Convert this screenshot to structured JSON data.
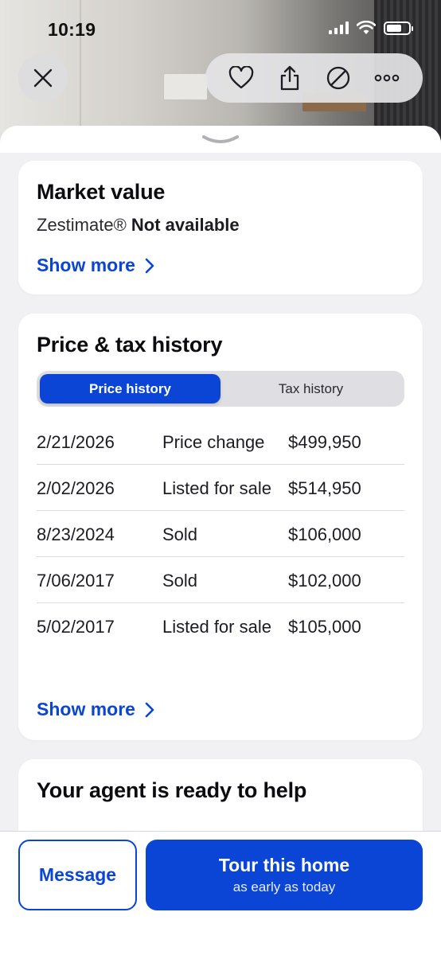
{
  "status_bar": {
    "time": "10:19"
  },
  "top_actions": {
    "close_icon": "close-icon",
    "actions": [
      "heart-icon",
      "share-icon",
      "hide-icon",
      "more-icon"
    ]
  },
  "market_value": {
    "title": "Market value",
    "zestimate_label": "Zestimate®",
    "zestimate_value": "Not available",
    "show_more": "Show more"
  },
  "price_tax_history": {
    "title": "Price & tax history",
    "tabs": [
      "Price history",
      "Tax history"
    ],
    "active_tab": "Price history",
    "rows": [
      {
        "date": "2/21/2026",
        "event": "Price change",
        "price": "$499,950"
      },
      {
        "date": "2/02/2026",
        "event": "Listed for sale",
        "price": "$514,950"
      },
      {
        "date": "8/23/2024",
        "event": "Sold",
        "price": "$106,000"
      },
      {
        "date": "7/06/2017",
        "event": "Sold",
        "price": "$102,000"
      },
      {
        "date": "5/02/2017",
        "event": "Listed for sale",
        "price": "$105,000"
      }
    ],
    "show_more": "Show more"
  },
  "agent": {
    "title": "Your agent is ready to help"
  },
  "bottom_bar": {
    "message_label": "Message",
    "tour_label": "Tour this home",
    "tour_sublabel": "as early as today"
  },
  "colors": {
    "accent": "#0a45d6",
    "background": "#f1f1f3",
    "card": "#ffffff"
  }
}
